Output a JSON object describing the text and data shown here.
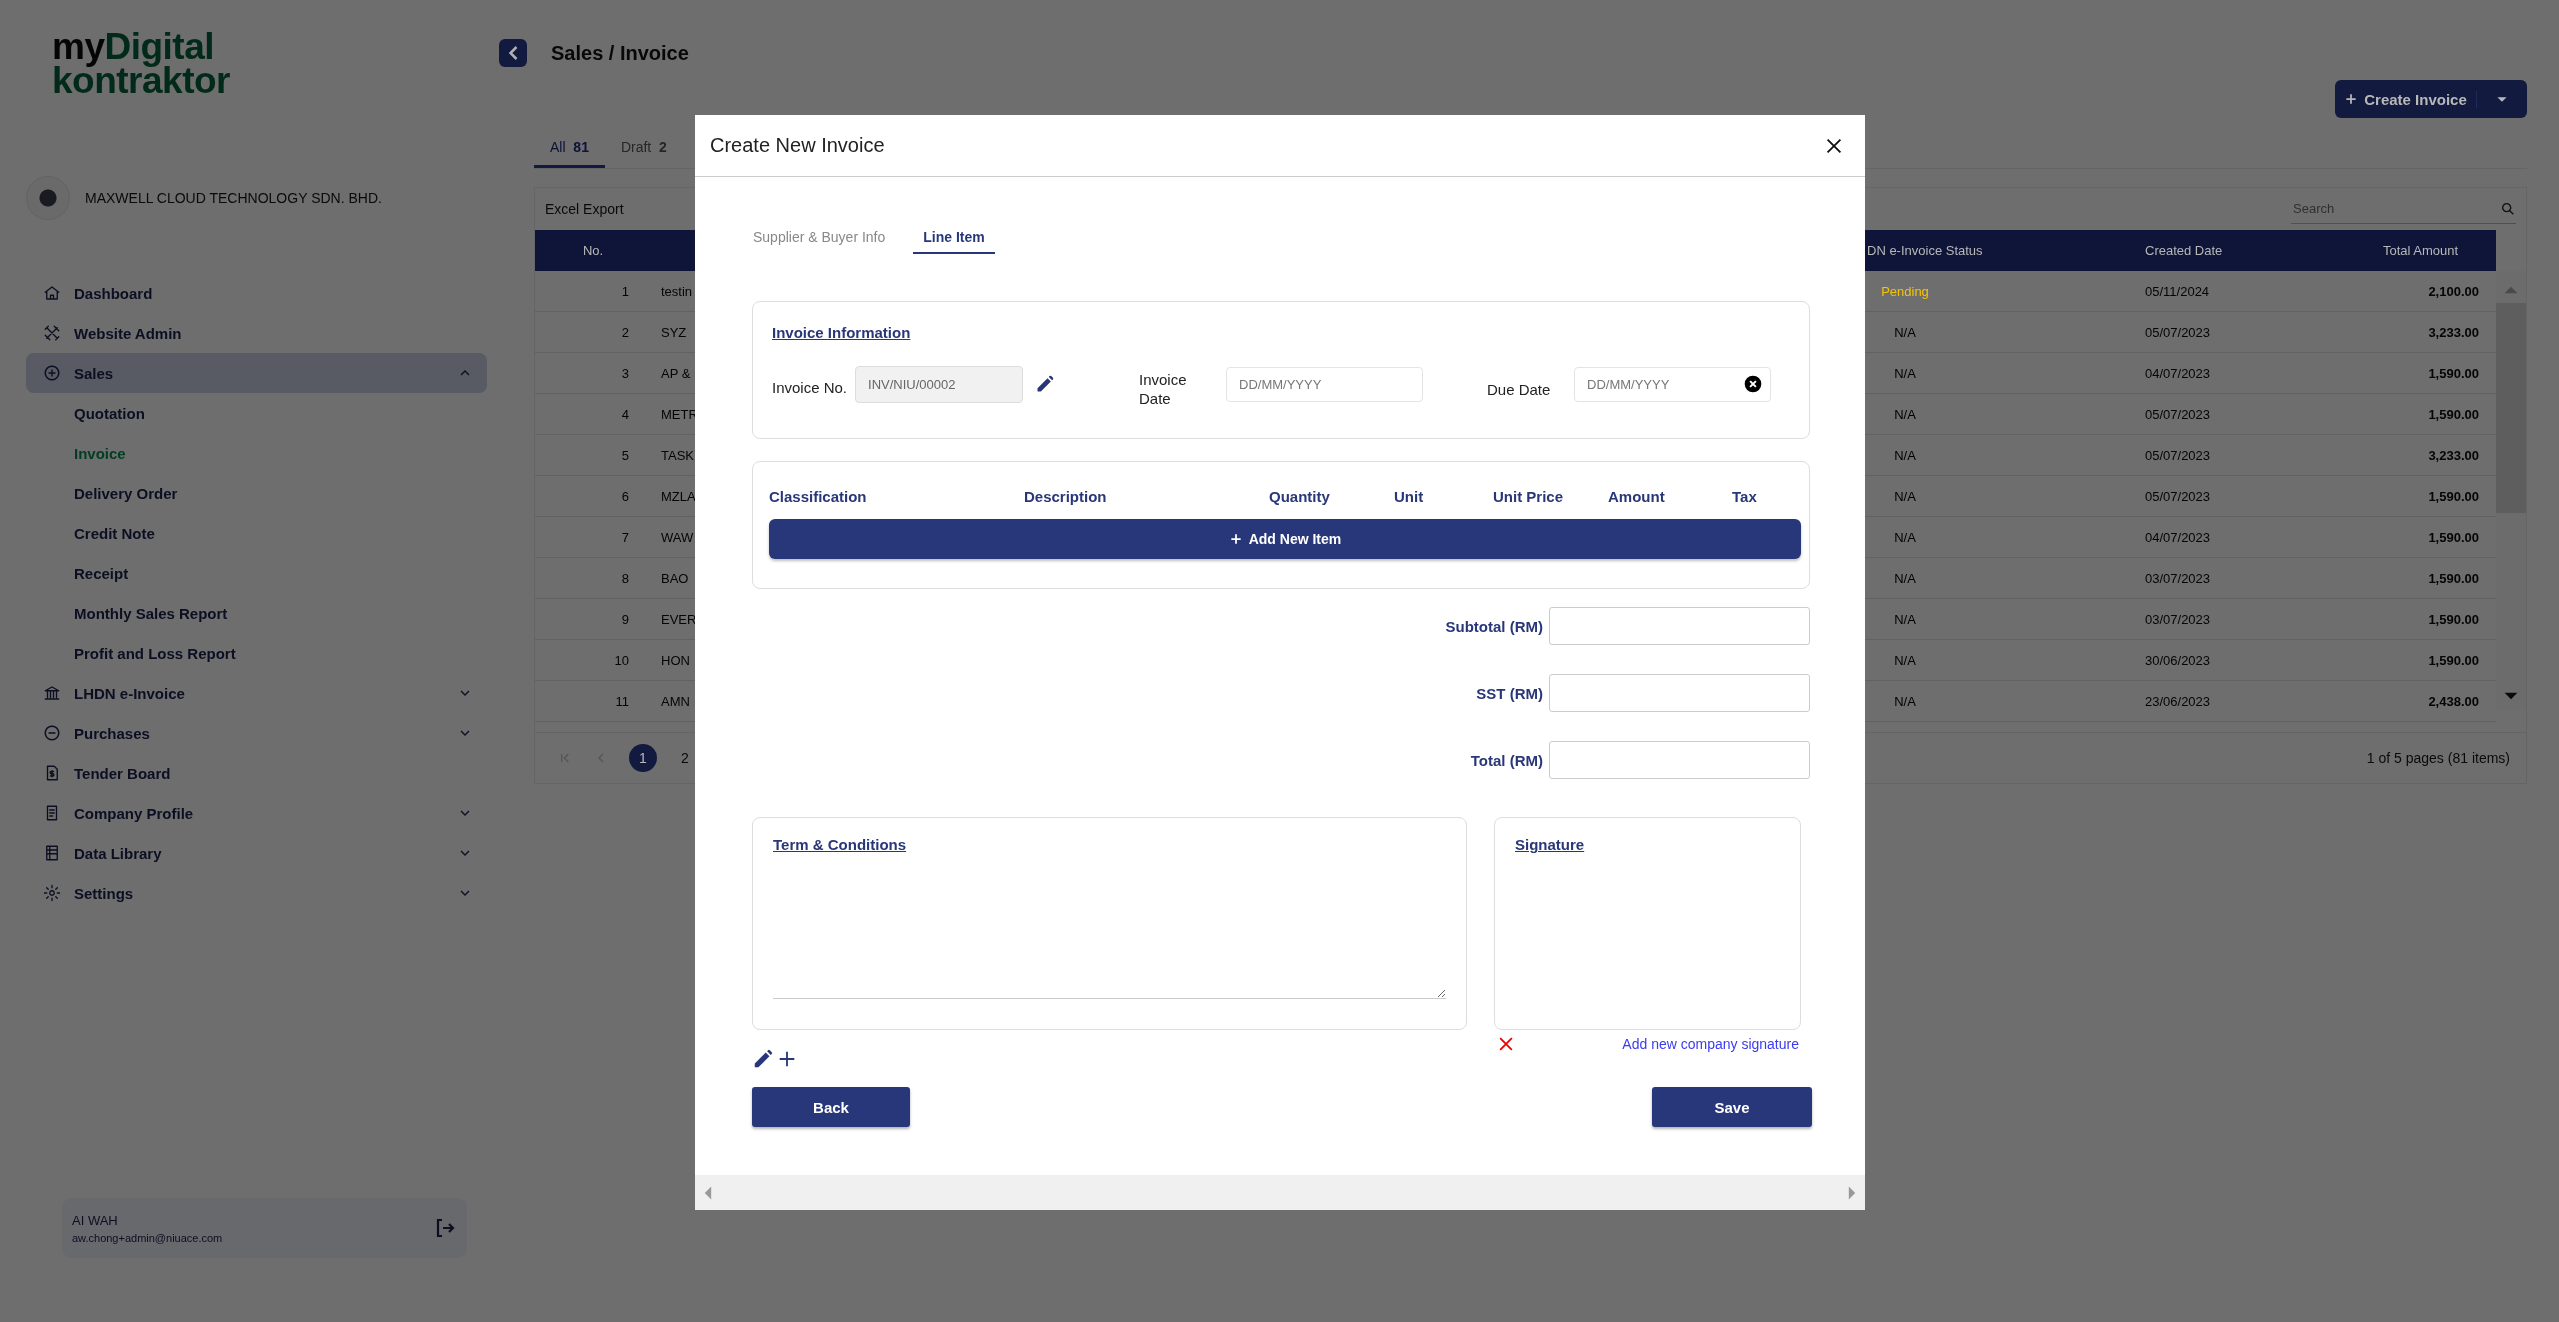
{
  "logo": {
    "first": "my",
    "second": "Digital",
    "third": "kontraktor"
  },
  "company": {
    "name": "MAXWELL CLOUD TECHNOLOGY SDN. BHD."
  },
  "sidebar": {
    "items": [
      {
        "label": "Dashboard",
        "selected": false,
        "kind": "link"
      },
      {
        "label": "Website Admin",
        "selected": false,
        "kind": "link"
      },
      {
        "label": "Sales",
        "selected": true,
        "kind": "group",
        "expanded": true,
        "children": [
          {
            "label": "Quotation",
            "selected": false
          },
          {
            "label": "Invoice",
            "selected": true
          },
          {
            "label": "Delivery Order",
            "selected": false
          },
          {
            "label": "Credit Note",
            "selected": false
          },
          {
            "label": "Receipt",
            "selected": false
          },
          {
            "label": "Monthly Sales Report",
            "selected": false
          },
          {
            "label": "Profit and Loss Report",
            "selected": false
          }
        ]
      },
      {
        "label": "LHDN e-Invoice",
        "selected": false,
        "kind": "group",
        "expanded": false
      },
      {
        "label": "Purchases",
        "selected": false,
        "kind": "group",
        "expanded": false
      },
      {
        "label": "Tender Board",
        "selected": false,
        "kind": "link"
      },
      {
        "label": "Company Profile",
        "selected": false,
        "kind": "group",
        "expanded": false
      },
      {
        "label": "Data Library",
        "selected": false,
        "kind": "group",
        "expanded": false
      },
      {
        "label": "Settings",
        "selected": false,
        "kind": "group",
        "expanded": false
      }
    ]
  },
  "user": {
    "name": "AI WAH",
    "email": "aw.chong+admin@niuace.com"
  },
  "page": {
    "breadcrumb": "Sales / Invoice",
    "create_button": "Create Invoice"
  },
  "tabs": [
    {
      "label": "All",
      "count": "81",
      "selected": true
    },
    {
      "label": "Draft",
      "count": "2",
      "selected": false
    }
  ],
  "toolbar": {
    "export": "Excel Export",
    "search_placeholder": "Search"
  },
  "table": {
    "columns": [
      "No.",
      "DN e-Invoice Status",
      "Created Date",
      "Total Amount"
    ],
    "rows": [
      {
        "no": "1",
        "column_2": "testin",
        "status": "Pending",
        "color": "#f5c400",
        "created": "05/11/2024",
        "total": "2,100.00"
      },
      {
        "no": "2",
        "column_2": "SYZ",
        "status": "N/A",
        "color": "#000000",
        "created": "05/07/2023",
        "total": "3,233.00"
      },
      {
        "no": "3",
        "column_2": "AP &",
        "status": "N/A",
        "color": "#000000",
        "created": "04/07/2023",
        "total": "1,590.00"
      },
      {
        "no": "4",
        "column_2": "METR",
        "status": "N/A",
        "color": "#000000",
        "created": "05/07/2023",
        "total": "1,590.00"
      },
      {
        "no": "5",
        "column_2": "TASK",
        "status": "N/A",
        "color": "#000000",
        "created": "05/07/2023",
        "total": "3,233.00"
      },
      {
        "no": "6",
        "column_2": "MZLA",
        "status": "N/A",
        "color": "#000000",
        "created": "05/07/2023",
        "total": "1,590.00"
      },
      {
        "no": "7",
        "column_2": "WAW",
        "status": "N/A",
        "color": "#000000",
        "created": "04/07/2023",
        "total": "1,590.00"
      },
      {
        "no": "8",
        "column_2": "BAO",
        "status": "N/A",
        "color": "#000000",
        "created": "03/07/2023",
        "total": "1,590.00"
      },
      {
        "no": "9",
        "column_2": "EVER",
        "status": "N/A",
        "color": "#000000",
        "created": "03/07/2023",
        "total": "1,590.00"
      },
      {
        "no": "10",
        "column_2": "HON",
        "status": "N/A",
        "color": "#000000",
        "created": "30/06/2023",
        "total": "1,590.00"
      },
      {
        "no": "11",
        "column_2": "AMN",
        "status": "N/A",
        "color": "#000000",
        "created": "23/06/2023",
        "total": "2,438.00"
      }
    ]
  },
  "pagination": {
    "pages": [
      {
        "label": "1",
        "selected": true
      },
      {
        "label": "2",
        "selected": false
      }
    ],
    "info": "1 of 5 pages (81 items)"
  },
  "modal": {
    "title": "Create New Invoice",
    "tabs": [
      {
        "label": "Supplier & Buyer Info",
        "selected": false
      },
      {
        "label": "Line Item",
        "selected": true
      }
    ],
    "invoice_info": {
      "title": "Invoice Information",
      "fields": [
        {
          "label": "Invoice No.",
          "kind": "readonly",
          "value": "INV/NIU/00002"
        },
        {
          "label": "Invoice Date",
          "kind": "date",
          "placeholder": "DD/MM/YYYY"
        },
        {
          "label": "Due Date",
          "kind": "clearable",
          "placeholder": "DD/MM/YYYY"
        }
      ]
    },
    "line_items": {
      "columns": [
        "Classification",
        "Description",
        "Quantity",
        "Unit",
        "Unit Price",
        "Amount",
        "Tax"
      ],
      "add_button": "Add New Item"
    },
    "totals": [
      {
        "label": "Subtotal (RM)"
      },
      {
        "label": "SST (RM)"
      },
      {
        "label": "Total (RM)"
      }
    ],
    "terms": {
      "title": "Term & Conditions"
    },
    "signature": {
      "title": "Signature",
      "add_link": "Add new company signature"
    },
    "buttons": {
      "back": "Back",
      "save": "Save"
    }
  }
}
